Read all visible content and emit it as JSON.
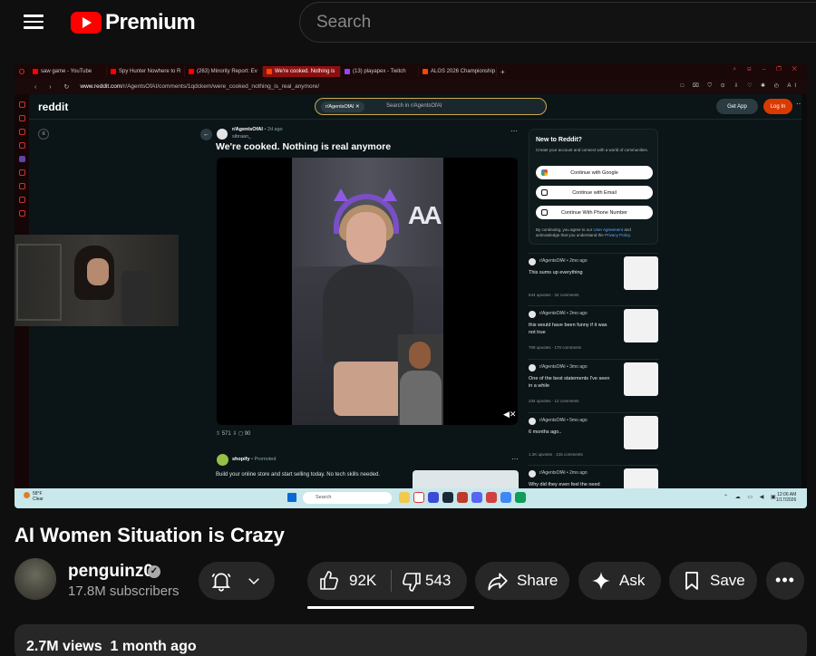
{
  "youtube": {
    "logo_text": "Premium",
    "search_placeholder": "Search"
  },
  "browser": {
    "tabs": [
      {
        "label": "saw game - YouTube",
        "color": "#ff0000"
      },
      {
        "label": "Spy Hunter Nowhere to R",
        "color": "#ff0000"
      },
      {
        "label": "(263) Minority Report: Ev",
        "color": "#ff0000"
      },
      {
        "label": "We're cooked. Nothing is",
        "color": "#ff4500",
        "active": true
      },
      {
        "label": "(13) playapex - Twitch",
        "color": "#9146ff"
      },
      {
        "label": "ALGS 2026 Championship",
        "color": "#ff4500"
      }
    ],
    "url_host": "www.reddit.com",
    "url_path": "/r/AgentsOfAI/comments/1qdckem/were_cooked_nothing_is_real_anymore/"
  },
  "reddit": {
    "logo": "reddit",
    "search_chip": "r/AgentsOfAI",
    "search_placeholder": "Search in r/AgentsOfAI",
    "get_app": "Get App",
    "login": "Log In",
    "post": {
      "subreddit": "r/AgentsOfAI",
      "age": "• 2d ago",
      "user": "sibraan_",
      "title": "We're cooked. Nothing is real anymore",
      "actions": "⇧ 571 ⇩   ◻ 90"
    },
    "ad": {
      "name": "shopify",
      "tag": "• Promoted",
      "text": "Build your online store and start selling today. No tech skills needed."
    },
    "signup": {
      "title": "New to Reddit?",
      "desc": "Create your account and connect with a world of communities.",
      "google": "Continue with Google",
      "email": "Continue with Email",
      "phone": "Continue With Phone Number",
      "terms_a": "By continuing, you agree to our ",
      "terms_link1": "User Agreement",
      "terms_b": " and acknowledge that you understand the ",
      "terms_link2": "Privacy Policy",
      "terms_c": "."
    },
    "feed": [
      {
        "sub": "r/AgentsOfAI • 2mo ago",
        "title": "This sums up everything",
        "meta": "644 upvotes  ·  34 comments"
      },
      {
        "sub": "r/AgentsOfAI • 2mo ago",
        "title": "this would have been funny if it was not true",
        "meta": "709 upvotes  ·  170 comments"
      },
      {
        "sub": "r/AgentsOfAI • 3mo ago",
        "title": "One of the best statements I've seen in a while",
        "meta": "234 upvotes  ·  12 comments"
      },
      {
        "sub": "r/AgentsOfAI • 5mo ago",
        "title": "6 months ago..",
        "meta": "1.2K upvotes  ·  215 comments"
      },
      {
        "sub": "r/AgentsOfAI • 2mo ago",
        "title": "Why did they even feel the need",
        "meta": ""
      }
    ]
  },
  "taskbar": {
    "weather_temp": "58°F",
    "weather_desc": "Clear",
    "search": "Search",
    "time": "12:06 AM",
    "date": "1/17/2026"
  },
  "video": {
    "title": "AI Women Situation is Crazy",
    "channel": "penguinz0",
    "subscribers": "17.8M subscribers",
    "likes": "92K",
    "dislikes": "543",
    "share": "Share",
    "ask": "Ask",
    "save": "Save",
    "views": "2.7M views",
    "age": "1 month ago"
  }
}
